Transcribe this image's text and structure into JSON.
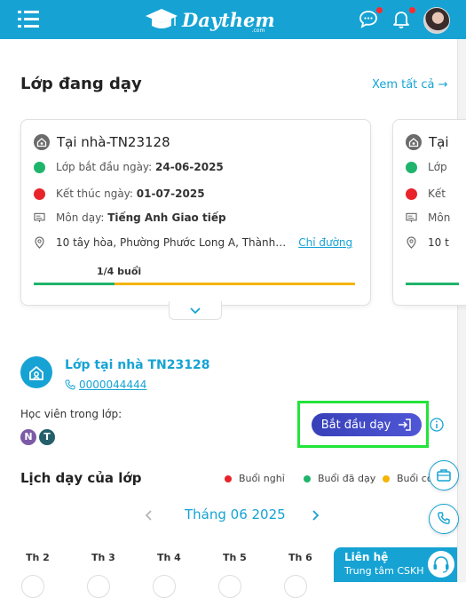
{
  "header": {
    "logo_text": "Daythem",
    "logo_sub": ".com"
  },
  "section": {
    "title": "Lớp đang dạy",
    "see_all": "Xem tất cả →"
  },
  "cards": [
    {
      "title": "Tại nhà-TN23128",
      "start_label": "Lớp bắt đầu ngày:",
      "start_date": "24-06-2025",
      "end_label": "Kết thúc ngày:",
      "end_date": "01-07-2025",
      "subject_label": "Môn dạy:",
      "subject": "Tiếng Anh Giao tiếp",
      "address": "10 tây hòa, Phường Phước Long A, Thành…",
      "directions": "Chỉ đường",
      "progress_text": "1/4 buổi",
      "progress": 0.25
    },
    {
      "title": "Tại",
      "start_label": "Lớp",
      "end_label": "Kết",
      "subject_label": "Môn",
      "address": "10 t"
    }
  ],
  "class_info": {
    "name": "Lớp tại nhà TN23128",
    "phone": "0000044444",
    "students_label": "Học viên trong lớp:",
    "students": [
      "N",
      "T"
    ],
    "start_button": "Bắt đầu dạy"
  },
  "schedule": {
    "title": "Lịch dạy của lớp",
    "legend": [
      "Buổi nghỉ",
      "Buổi đã dạy",
      "Buổi còn"
    ],
    "month": "Tháng 06 2025",
    "weekdays": [
      "Th 2",
      "Th 3",
      "Th 4",
      "Th 5",
      "Th 6"
    ]
  },
  "contact": {
    "title": "Liên hệ",
    "subtitle": "Trung tâm CSKH"
  },
  "colors": {
    "brand": "#16a3d4",
    "green": "#1fb46b",
    "red": "#e8232a",
    "yellow": "#f4b400",
    "button": "#3c45c2"
  }
}
